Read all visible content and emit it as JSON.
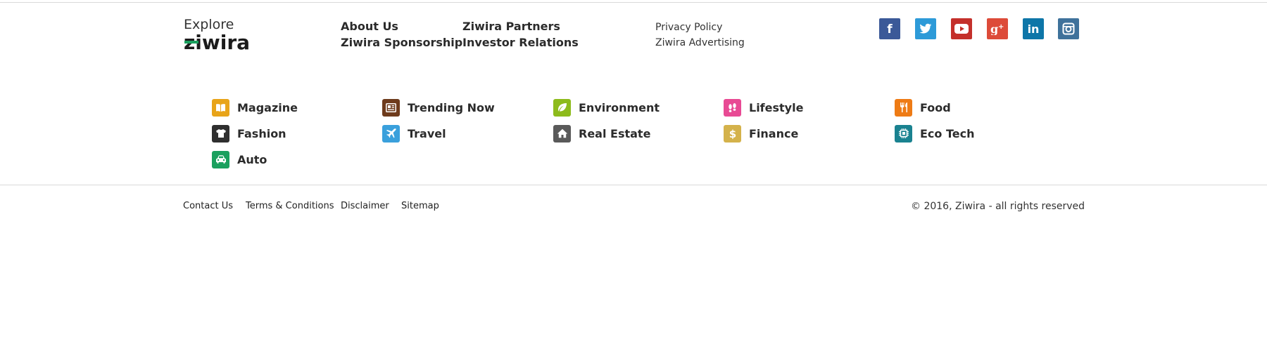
{
  "explore": {
    "label": "Explore",
    "logo_text": "ziwira"
  },
  "nav": {
    "about_us": "About Us",
    "sponsorship": "Ziwira Sponsorship",
    "partners": "Ziwira Partners",
    "investor_relations": "Investor Relations",
    "privacy_policy": "Privacy Policy",
    "advertising": "Ziwira Advertising"
  },
  "social": [
    {
      "icon": "facebook-icon",
      "color": "#3b5998"
    },
    {
      "icon": "twitter-icon",
      "color": "#2d9ad8"
    },
    {
      "icon": "youtube-icon",
      "color": "#c4302b"
    },
    {
      "icon": "google-plus-icon",
      "color": "#dd4b39"
    },
    {
      "icon": "linkedin-icon",
      "color": "#0e76a8"
    },
    {
      "icon": "instagram-icon",
      "color": "#3f729b"
    }
  ],
  "categories": [
    {
      "label": "Magazine",
      "icon": "book-icon",
      "color": "#e8a419"
    },
    {
      "label": "Trending Now",
      "icon": "newspaper-icon",
      "color": "#6e3b1c"
    },
    {
      "label": "Environment",
      "icon": "leaf-icon",
      "color": "#8dbb1b"
    },
    {
      "label": "Lifestyle",
      "icon": "footprints-icon",
      "color": "#e84a94"
    },
    {
      "label": "Food",
      "icon": "cutlery-icon",
      "color": "#ee7b15"
    },
    {
      "label": "Fashion",
      "icon": "shirt-icon",
      "color": "#2f2f2f"
    },
    {
      "label": "Travel",
      "icon": "airplane-icon",
      "color": "#3aa0dc"
    },
    {
      "label": "Real Estate",
      "icon": "house-icon",
      "color": "#5a5a5a"
    },
    {
      "label": "Finance",
      "icon": "dollar-icon",
      "color": "#d4b24b"
    },
    {
      "label": "Eco Tech",
      "icon": "chip-icon",
      "color": "#1a8290"
    },
    {
      "label": "Auto",
      "icon": "car-icon",
      "color": "#1aa05e"
    }
  ],
  "footer": {
    "contact_us": "Contact Us",
    "terms": "Terms & Conditions",
    "disclaimer": "Disclaimer",
    "sitemap": "Sitemap",
    "copyright": "© 2016, Ziwira - all rights reserved"
  }
}
